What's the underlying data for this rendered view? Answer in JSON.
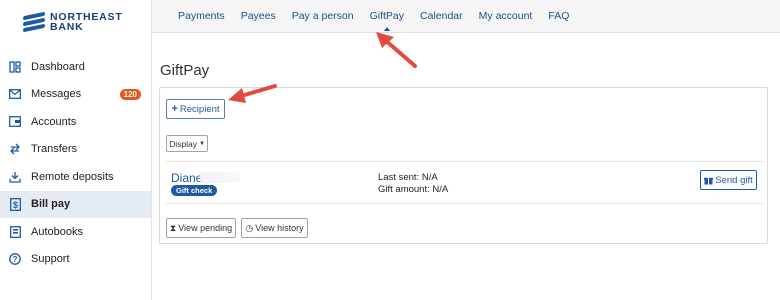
{
  "sidebar": {
    "logo": {
      "line1": "NORTHEAST",
      "line2": "BANK"
    },
    "items": [
      {
        "label": "Dashboard",
        "icon": "dashboard-icon"
      },
      {
        "label": "Messages",
        "icon": "envelope-icon",
        "badge": "120"
      },
      {
        "label": "Accounts",
        "icon": "wallet-icon"
      },
      {
        "label": "Transfers",
        "icon": "transfer-icon"
      },
      {
        "label": "Remote deposits",
        "icon": "download-icon"
      },
      {
        "label": "Bill pay",
        "icon": "dollar-icon",
        "active": true
      },
      {
        "label": "Autobooks",
        "icon": "autobooks-icon"
      },
      {
        "label": "Support",
        "icon": "help-icon"
      }
    ]
  },
  "topnav": {
    "items": [
      "Payments",
      "Payees",
      "Pay a person",
      "GiftPay",
      "Calendar",
      "My account",
      "FAQ"
    ],
    "active": "GiftPay"
  },
  "main": {
    "title": "GiftPay",
    "recipient_button": "Recipient",
    "display_button": "Display",
    "recipient": {
      "name": "Diane",
      "tag": "Gift check",
      "last_sent": "Last sent: N/A",
      "gift_amount": "Gift amount: N/A"
    },
    "send_gift_button": "Send gift",
    "view_pending_button": "View pending",
    "view_history_button": "View history"
  },
  "colors": {
    "accent": "#1d5aa3",
    "badge": "#e05a1e",
    "arrow": "#e24a42"
  }
}
